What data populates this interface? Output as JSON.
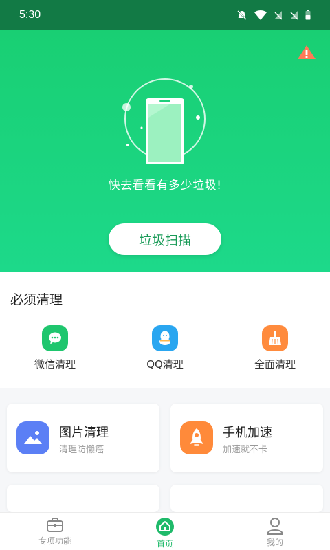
{
  "status_bar": {
    "time": "5:30"
  },
  "hero": {
    "tagline": "快去看看有多少垃圾!",
    "scan_button": "垃圾扫描"
  },
  "section": {
    "title": "必须清理"
  },
  "quick_items": [
    {
      "label": "微信清理",
      "icon": "wechat-icon",
      "color": "#1fc66e"
    },
    {
      "label": "QQ清理",
      "icon": "qq-icon",
      "color": "#2aa6f0"
    },
    {
      "label": "全面清理",
      "icon": "broom-icon",
      "color": "#ff8b3d"
    }
  ],
  "cards": [
    {
      "title": "图片清理",
      "subtitle": "清理防懒癌",
      "icon": "image-icon",
      "color": "#5b7ff5"
    },
    {
      "title": "手机加速",
      "subtitle": "加速就不卡",
      "icon": "rocket-icon",
      "color": "#ff8a3a"
    }
  ],
  "tabbar": {
    "tabs": [
      {
        "label": "专项功能",
        "icon": "briefcase-icon",
        "active": false
      },
      {
        "label": "首页",
        "icon": "home-icon",
        "active": true
      },
      {
        "label": "我的",
        "icon": "user-icon",
        "active": false
      }
    ]
  },
  "colors": {
    "primary": "#1dd27d",
    "status_bar": "#127a45",
    "accent_text": "#1a9b58"
  }
}
